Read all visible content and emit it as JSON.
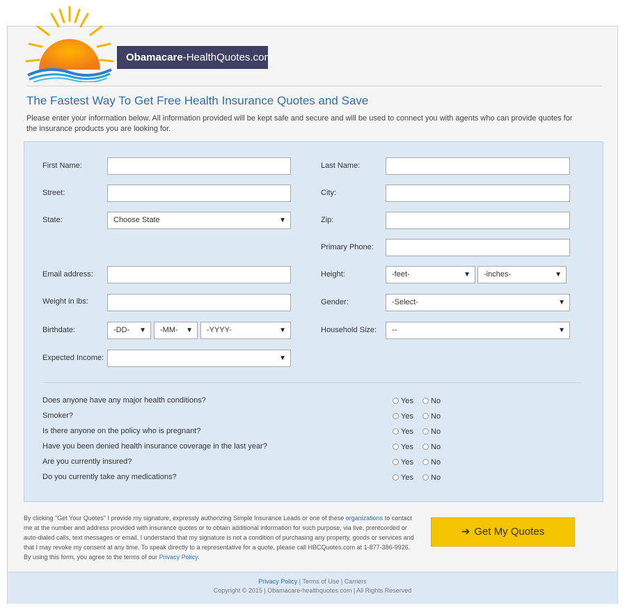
{
  "brand": {
    "name_bold": "Obamacare",
    "name_rest": "-HealthQuotes.com"
  },
  "headline": "The Fastest Way To Get Free Health Insurance Quotes and Save",
  "intro": "Please enter your information below. All information provided will be kept safe and secure and will be used to connect you with agents who can provide quotes for the insurance products you are looking for.",
  "form": {
    "first_name_label": "First Name:",
    "last_name_label": "Last Name:",
    "street_label": "Street:",
    "city_label": "City:",
    "state_label": "State:",
    "state_value": "Choose State",
    "zip_label": "Zip:",
    "phone_label": "Primary Phone:",
    "email_label": "Email address:",
    "height_label": "Height:",
    "height_feet": "-feet-",
    "height_inches": "-inches-",
    "weight_label": "Weight in lbs:",
    "gender_label": "Gender:",
    "gender_value": "-Select-",
    "birthdate_label": "Birthdate:",
    "birth_dd": "-DD-",
    "birth_mm": "-MM-",
    "birth_yyyy": "-YYYY-",
    "household_label": "Household Size:",
    "household_value": "--",
    "income_label": "Expected Income:",
    "income_value": ""
  },
  "questions": [
    {
      "text": "Does anyone have any major health conditions?",
      "yes": "Yes",
      "no": "No"
    },
    {
      "text": "Smoker?",
      "yes": "Yes",
      "no": "No"
    },
    {
      "text": "Is there anyone on the policy who is pregnant?",
      "yes": "Yes",
      "no": "No"
    },
    {
      "text": "Have you been denied health insurance coverage in the last year?",
      "yes": "Yes",
      "no": "No"
    },
    {
      "text": "Are you currently insured?",
      "yes": "Yes",
      "no": "No"
    },
    {
      "text": "Do you currently take any medications?",
      "yes": "Yes",
      "no": "No"
    }
  ],
  "disclaimer": {
    "part1": "By clicking \"Get Your Quotes\" I provide my signature, expressly authorizing Simple Insurance Leads or one of these ",
    "link1": "organizations",
    "part2": " to contact me at the number and address provided with insurance quotes or to obtain additional information for such purpose, via live, prerecorded or auto-dialed calls, text messages or email. I understand that my signature is not a condition of purchasing any property, goods or services and that I may revoke my consent at any time. To speak directly to a representative for a quote, please call HBCQuotes.com at 1-877-386-9926. By using this form, you agree to the terms of our ",
    "link2": "Privacy Policy",
    "part3": "."
  },
  "cta": {
    "arrow": "➔",
    "label": "Get My Quotes"
  },
  "footer": {
    "privacy": "Privacy Policy",
    "sep1": " | ",
    "terms": "Terms of Use",
    "sep2": " | ",
    "carriers": "Carriers",
    "copyright": "Copyright © 2015 | Obamacare-healthquotes.com | All Rights Reserved"
  },
  "colors": {
    "accent_blue": "#2e6fb0",
    "panel_blue": "#dce9f5",
    "cta_yellow": "#f5c400",
    "badge_navy": "#3f3f63"
  }
}
